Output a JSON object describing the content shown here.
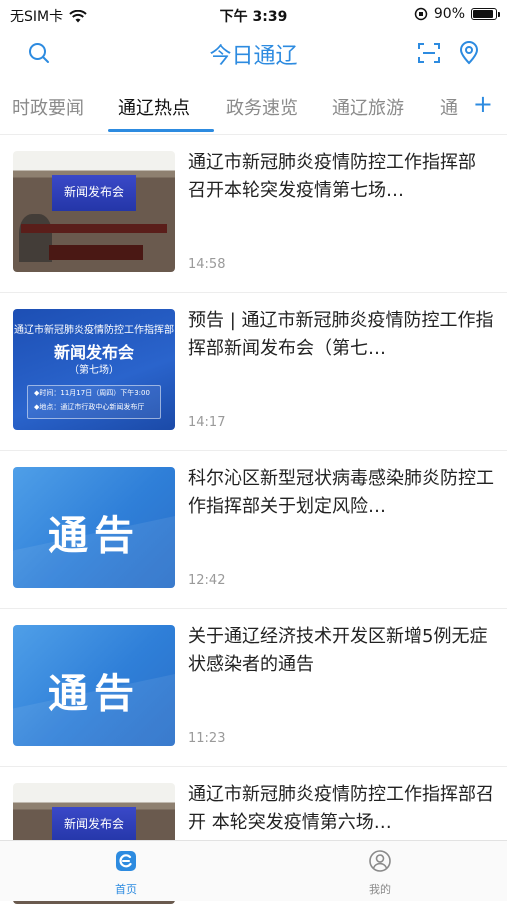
{
  "status_bar": {
    "carrier": "无SIM卡",
    "time": "下午 3:39",
    "battery": "90%",
    "battery_level": 0.9
  },
  "header": {
    "title": "今日通辽",
    "left_icon": "search-icon",
    "right_icons": [
      "scan-icon",
      "location-pin-icon"
    ]
  },
  "tabs": {
    "items": [
      "时政要闻",
      "通辽热点",
      "政务速览",
      "通辽旅游",
      "通"
    ],
    "active_index": 1,
    "add_icon": "+"
  },
  "news": [
    {
      "title": "通辽市新冠肺炎疫情防控工作指挥部 召开本轮突发疫情第七场…",
      "time": "14:58",
      "thumb_type": "conference",
      "thumb_text": "新闻发布会"
    },
    {
      "title": "预告 | 通辽市新冠肺炎疫情防控工作指挥部新闻发布会（第七…",
      "time": "14:17",
      "thumb_type": "poster",
      "thumb_lines": [
        "通辽市新冠肺炎疫情防控工作指挥部",
        "新闻发布会",
        "（第七场）",
        "◆时间：11月17日（周四）下午3:00",
        "◆地点：通辽市行政中心新闻发布厅"
      ]
    },
    {
      "title": "科尔沁区新型冠状病毒感染肺炎防控工作指挥部关于划定风险…",
      "time": "12:42",
      "thumb_type": "notice",
      "thumb_text": "通告"
    },
    {
      "title": "关于通辽经济技术开发区新增5例无症状感染者的通告",
      "time": "11:23",
      "thumb_type": "notice",
      "thumb_text": "通告"
    },
    {
      "title": "通辽市新冠肺炎疫情防控工作指挥部召开 本轮突发疫情第六场…",
      "time": "",
      "thumb_type": "conference",
      "thumb_text": "新闻发布会"
    }
  ],
  "tabbar": {
    "items": [
      {
        "label": "首页",
        "icon": "home-logo-icon",
        "active": true
      },
      {
        "label": "我的",
        "icon": "profile-icon",
        "active": false
      }
    ]
  },
  "colors": {
    "accent": "#2d8be0",
    "inactive": "#8a8a8a"
  }
}
